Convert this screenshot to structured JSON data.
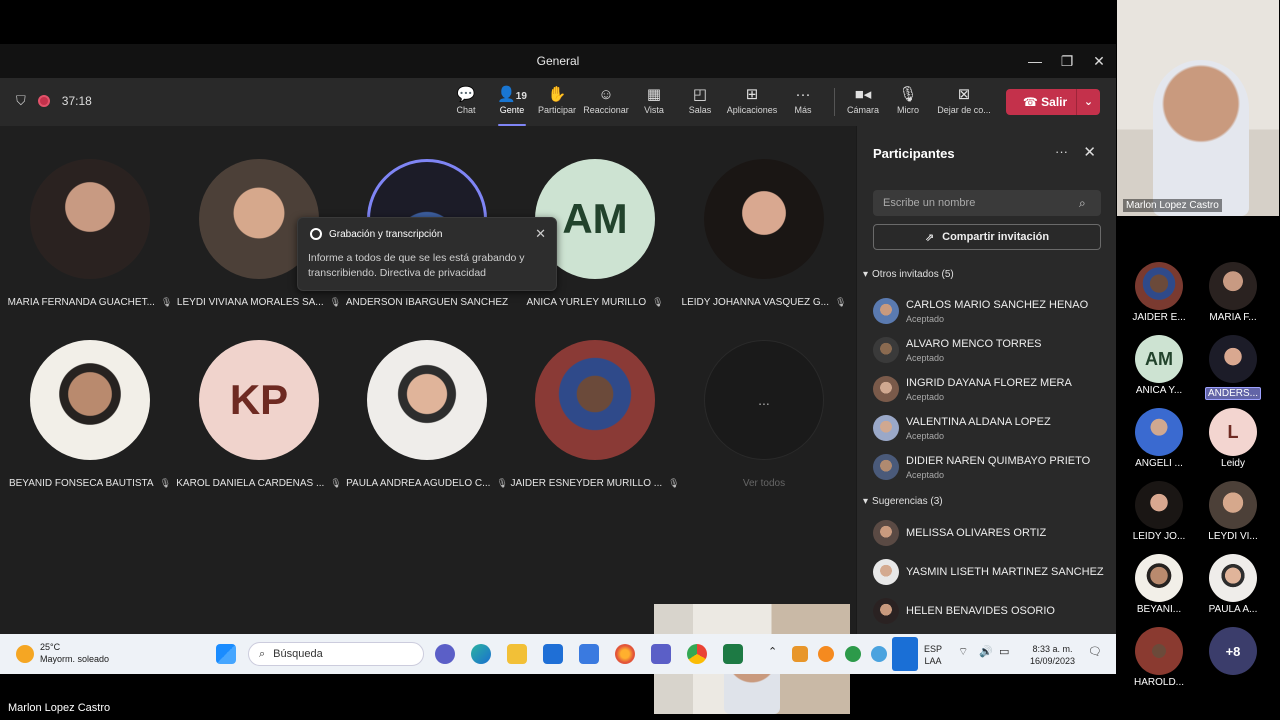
{
  "window": {
    "title": "General"
  },
  "meeting": {
    "timer": "37:18"
  },
  "toolbar": {
    "chat": "Chat",
    "people": "Gente",
    "people_count": "19",
    "participate": "Participar",
    "react": "Reaccionar",
    "view": "Vista",
    "rooms": "Salas",
    "apps": "Aplicaciones",
    "more": "Más",
    "camera": "Cámara",
    "mic": "Micro",
    "share": "Dejar de co...",
    "leave": "Salir"
  },
  "toast": {
    "title": "Grabación y transcripción",
    "body": "Informe a todos de que se les está grabando y transcribiendo. Directiva de privacidad"
  },
  "tiles": [
    {
      "name": "MARIA FERNANDA GUACHET...",
      "color": "#5a4a42"
    },
    {
      "name": "LEYDI VIVIANA MORALES SA...",
      "color": "#6b5a50"
    },
    {
      "name": "ANDERSON IBARGUEN SANCHEZ",
      "color": "#2f3b57"
    },
    {
      "name": "ANICA YURLEY MURILLO",
      "initials": "AM",
      "color": "#cde3d2"
    },
    {
      "name": "LEIDY JOHANNA VASQUEZ G...",
      "color": "#3b3330"
    },
    {
      "name": "BEYANID FONSECA BAUTISTA",
      "color": "#d8c7b0"
    },
    {
      "name": "KAROL DANIELA CARDENAS ...",
      "initials": "KP",
      "color": "#f0d3cc"
    },
    {
      "name": "PAULA ANDREA AGUDELO C...",
      "color": "#cfc9c4"
    },
    {
      "name": "JAIDER ESNEYDER MURILLO ...",
      "color": "#8a3a36"
    }
  ],
  "see_all": {
    "glyph": "...",
    "label": "Ver todos"
  },
  "panel": {
    "title": "Participantes",
    "search_placeholder": "Escribe un nombre",
    "share_invite": "Compartir invitación",
    "invited_header": "Otros invitados (5)",
    "invited": [
      {
        "name": "CARLOS MARIO SANCHEZ HENAO",
        "status": "Aceptado"
      },
      {
        "name": "ALVARO MENCO TORRES",
        "status": "Aceptado"
      },
      {
        "name": "INGRID DAYANA FLOREZ MERA",
        "status": "Aceptado"
      },
      {
        "name": "VALENTINA ALDANA LOPEZ",
        "status": "Aceptado"
      },
      {
        "name": "DIDIER NAREN QUIMBAYO PRIETO",
        "status": "Aceptado"
      }
    ],
    "suggest_header": "Sugerencias (3)",
    "suggestions": [
      {
        "name": "MELISSA OLIVARES ORTIZ"
      },
      {
        "name": "YASMIN LISETH MARTINEZ SANCHEZ"
      },
      {
        "name": "HELEN BENAVIDES OSORIO"
      }
    ]
  },
  "taskbar": {
    "temp": "25°C",
    "weather": "Mayorm. soleado",
    "search": "Búsqueda",
    "lang1": "ESP",
    "lang2": "LAA",
    "time": "8:33 a. m.",
    "date": "16/09/2023"
  },
  "gallery": {
    "speaker": "Marlon  Lopez Castro",
    "items": [
      {
        "name": "JAIDER E...",
        "color": "#7a3a30"
      },
      {
        "name": "MARIA F...",
        "color": "#5a4a42"
      },
      {
        "name": "ANICA Y...",
        "initials": "AM",
        "color": "#cde3d2"
      },
      {
        "name": "ANDERS...",
        "color": "#2f3b57",
        "highlight": true
      },
      {
        "name": "ANGELI ...",
        "color": "#3a6ad0"
      },
      {
        "name": "Leidy",
        "initials": "L",
        "color": "#f3d5d0"
      },
      {
        "name": "LEIDY JO...",
        "color": "#3b3330"
      },
      {
        "name": "LEYDI VI...",
        "color": "#6b5a50"
      },
      {
        "name": "BEYANI...",
        "color": "#d8c7b0"
      },
      {
        "name": "PAULA A...",
        "color": "#cfc9c4"
      },
      {
        "name": "HAROLD...",
        "color": "#8a3a30"
      }
    ],
    "more_count": "+8"
  },
  "bottom_caption": "Marlon  Lopez Castro"
}
